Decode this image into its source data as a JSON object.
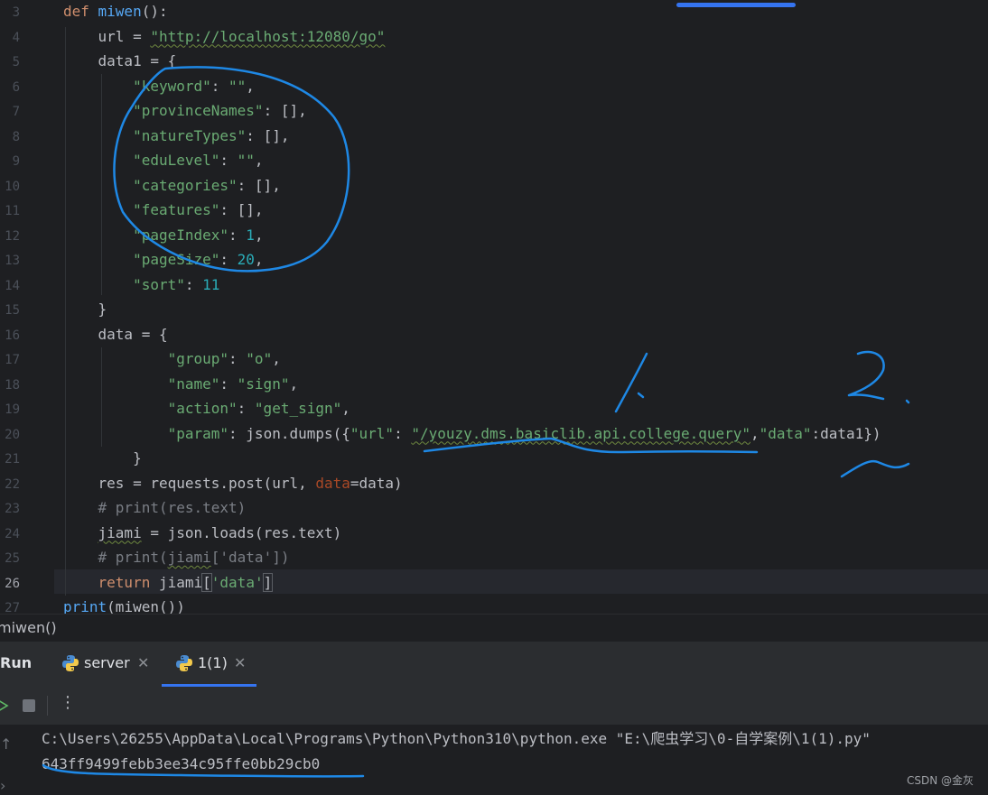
{
  "editor": {
    "lines": [
      {
        "num": "3",
        "tokens": [
          {
            "t": "def ",
            "c": "kw"
          },
          {
            "t": "miwen",
            "c": "fn"
          },
          {
            "t": "():",
            "c": ""
          }
        ]
      },
      {
        "num": "4",
        "tokens": [
          {
            "t": "    url = ",
            "c": ""
          },
          {
            "t": "\"http://localhost:12080/go\"",
            "c": "str wavy"
          }
        ]
      },
      {
        "num": "5",
        "tokens": [
          {
            "t": "    data1 = {",
            "c": ""
          }
        ]
      },
      {
        "num": "6",
        "tokens": [
          {
            "t": "        ",
            "c": ""
          },
          {
            "t": "\"keyword\"",
            "c": "str"
          },
          {
            "t": ": ",
            "c": ""
          },
          {
            "t": "\"\"",
            "c": "str"
          },
          {
            "t": ",",
            "c": ""
          }
        ]
      },
      {
        "num": "7",
        "tokens": [
          {
            "t": "        ",
            "c": ""
          },
          {
            "t": "\"provinceNames\"",
            "c": "str"
          },
          {
            "t": ": [],",
            "c": ""
          }
        ]
      },
      {
        "num": "8",
        "tokens": [
          {
            "t": "        ",
            "c": ""
          },
          {
            "t": "\"natureTypes\"",
            "c": "str"
          },
          {
            "t": ": [],",
            "c": ""
          }
        ]
      },
      {
        "num": "9",
        "tokens": [
          {
            "t": "        ",
            "c": ""
          },
          {
            "t": "\"eduLevel\"",
            "c": "str"
          },
          {
            "t": ": ",
            "c": ""
          },
          {
            "t": "\"\"",
            "c": "str"
          },
          {
            "t": ",",
            "c": ""
          }
        ]
      },
      {
        "num": "10",
        "tokens": [
          {
            "t": "        ",
            "c": ""
          },
          {
            "t": "\"categories\"",
            "c": "str"
          },
          {
            "t": ": [],",
            "c": ""
          }
        ]
      },
      {
        "num": "11",
        "tokens": [
          {
            "t": "        ",
            "c": ""
          },
          {
            "t": "\"features\"",
            "c": "str"
          },
          {
            "t": ": [],",
            "c": ""
          }
        ]
      },
      {
        "num": "12",
        "tokens": [
          {
            "t": "        ",
            "c": ""
          },
          {
            "t": "\"pageIndex\"",
            "c": "str"
          },
          {
            "t": ": ",
            "c": ""
          },
          {
            "t": "1",
            "c": "num"
          },
          {
            "t": ",",
            "c": ""
          }
        ]
      },
      {
        "num": "13",
        "tokens": [
          {
            "t": "        ",
            "c": ""
          },
          {
            "t": "\"pageSize\"",
            "c": "str"
          },
          {
            "t": ": ",
            "c": ""
          },
          {
            "t": "20",
            "c": "num"
          },
          {
            "t": ",",
            "c": ""
          }
        ]
      },
      {
        "num": "14",
        "tokens": [
          {
            "t": "        ",
            "c": ""
          },
          {
            "t": "\"sort\"",
            "c": "str"
          },
          {
            "t": ": ",
            "c": ""
          },
          {
            "t": "11",
            "c": "num"
          }
        ]
      },
      {
        "num": "15",
        "tokens": [
          {
            "t": "    }",
            "c": ""
          }
        ]
      },
      {
        "num": "16",
        "tokens": [
          {
            "t": "    data = {",
            "c": ""
          }
        ]
      },
      {
        "num": "17",
        "tokens": [
          {
            "t": "            ",
            "c": ""
          },
          {
            "t": "\"group\"",
            "c": "str"
          },
          {
            "t": ": ",
            "c": ""
          },
          {
            "t": "\"o\"",
            "c": "str"
          },
          {
            "t": ",",
            "c": ""
          }
        ]
      },
      {
        "num": "18",
        "tokens": [
          {
            "t": "            ",
            "c": ""
          },
          {
            "t": "\"name\"",
            "c": "str"
          },
          {
            "t": ": ",
            "c": ""
          },
          {
            "t": "\"sign\"",
            "c": "str"
          },
          {
            "t": ",",
            "c": ""
          }
        ]
      },
      {
        "num": "19",
        "tokens": [
          {
            "t": "            ",
            "c": ""
          },
          {
            "t": "\"action\"",
            "c": "str"
          },
          {
            "t": ": ",
            "c": ""
          },
          {
            "t": "\"get_sign\"",
            "c": "str"
          },
          {
            "t": ",",
            "c": ""
          }
        ]
      },
      {
        "num": "20",
        "tokens": [
          {
            "t": "            ",
            "c": ""
          },
          {
            "t": "\"param\"",
            "c": "str"
          },
          {
            "t": ": json.dumps({",
            "c": ""
          },
          {
            "t": "\"url\"",
            "c": "str"
          },
          {
            "t": ": ",
            "c": ""
          },
          {
            "t": "\"/youzy.dms.basiclib.api.college.query\"",
            "c": "str wavy"
          },
          {
            "t": ",",
            "c": ""
          },
          {
            "t": "\"data\"",
            "c": "str"
          },
          {
            "t": ":data1})",
            "c": ""
          }
        ]
      },
      {
        "num": "21",
        "tokens": [
          {
            "t": "        }",
            "c": ""
          }
        ]
      },
      {
        "num": "22",
        "tokens": [
          {
            "t": "    res = requests.post(url, ",
            "c": ""
          },
          {
            "t": "data",
            "c": "par"
          },
          {
            "t": "=data)",
            "c": ""
          }
        ]
      },
      {
        "num": "23",
        "tokens": [
          {
            "t": "    # print(res.text)",
            "c": "cmt"
          }
        ]
      },
      {
        "num": "24",
        "tokens": [
          {
            "t": "    ",
            "c": ""
          },
          {
            "t": "jiami",
            "c": "wavy"
          },
          {
            "t": " = json.loads(res.text)",
            "c": ""
          }
        ]
      },
      {
        "num": "25",
        "tokens": [
          {
            "t": "    # print(",
            "c": "cmt"
          },
          {
            "t": "jiami",
            "c": "cmt wavy"
          },
          {
            "t": "['data'])",
            "c": "cmt"
          }
        ]
      },
      {
        "num": "26",
        "tokens": [
          {
            "t": "    ",
            "c": ""
          },
          {
            "t": "return ",
            "c": "kw"
          },
          {
            "t": "jiami",
            "c": ""
          },
          {
            "t": "[",
            "c": "bm"
          },
          {
            "t": "'data'",
            "c": "str"
          },
          {
            "t": "]",
            "c": "bm"
          }
        ]
      },
      {
        "num": "27",
        "tokens": [
          {
            "t": "print",
            "c": "fn"
          },
          {
            "t": "(miwen())",
            "c": ""
          }
        ]
      }
    ],
    "current_line": "26"
  },
  "breadcrumb": "miwen()",
  "run_panel": {
    "title": "Run",
    "tabs": [
      {
        "label": "server",
        "active": false
      },
      {
        "label": "1(1)",
        "active": true
      }
    ],
    "console_lines": [
      "C:\\Users\\26255\\AppData\\Local\\Programs\\Python\\Python310\\python.exe \"E:\\爬虫学习\\0-自学案例\\1(1).py\"",
      "643ff9499febb3ee34c95ffe0bb29cb0"
    ]
  },
  "watermark": "CSDN @金灰",
  "annotations": {
    "label_1": "1.",
    "label_2": "2."
  },
  "colors": {
    "background": "#1e1f22",
    "panel": "#2b2d30",
    "keyword": "#cf8e6d",
    "function": "#56a8f5",
    "string": "#6aab73",
    "number": "#2aacb8",
    "comment": "#7a7e85",
    "ink": "#1e88e5"
  }
}
